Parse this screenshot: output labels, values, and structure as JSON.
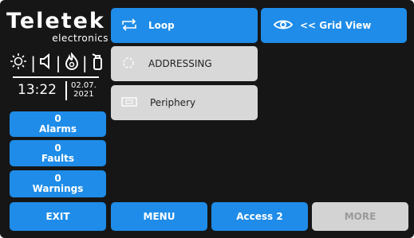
{
  "brand": {
    "name": "Teletek",
    "sub": "electronics"
  },
  "status": {
    "icons": [
      "sun-icon",
      "speaker-icon",
      "fire-icon",
      "extinguisher-icon"
    ],
    "time": "13:22",
    "date_day": "02.07.",
    "date_year": "2021"
  },
  "counters": {
    "alarms": {
      "count": "0",
      "label": "Alarms"
    },
    "faults": {
      "count": "0",
      "label": "Faults"
    },
    "warnings": {
      "count": "0",
      "label": "Warnings"
    }
  },
  "menu": {
    "loop": "Loop",
    "grid_view": "<< Grid View",
    "addressing": "ADDRESSING",
    "periphery": "Periphery"
  },
  "bottom": {
    "exit": "EXIT",
    "menu": "MENU",
    "access": "Access 2",
    "more": "MORE"
  },
  "colors": {
    "accent": "#1e8ce8",
    "background": "#161616",
    "item_grey": "#d8d8d8",
    "disabled": "#d3d3d3"
  }
}
